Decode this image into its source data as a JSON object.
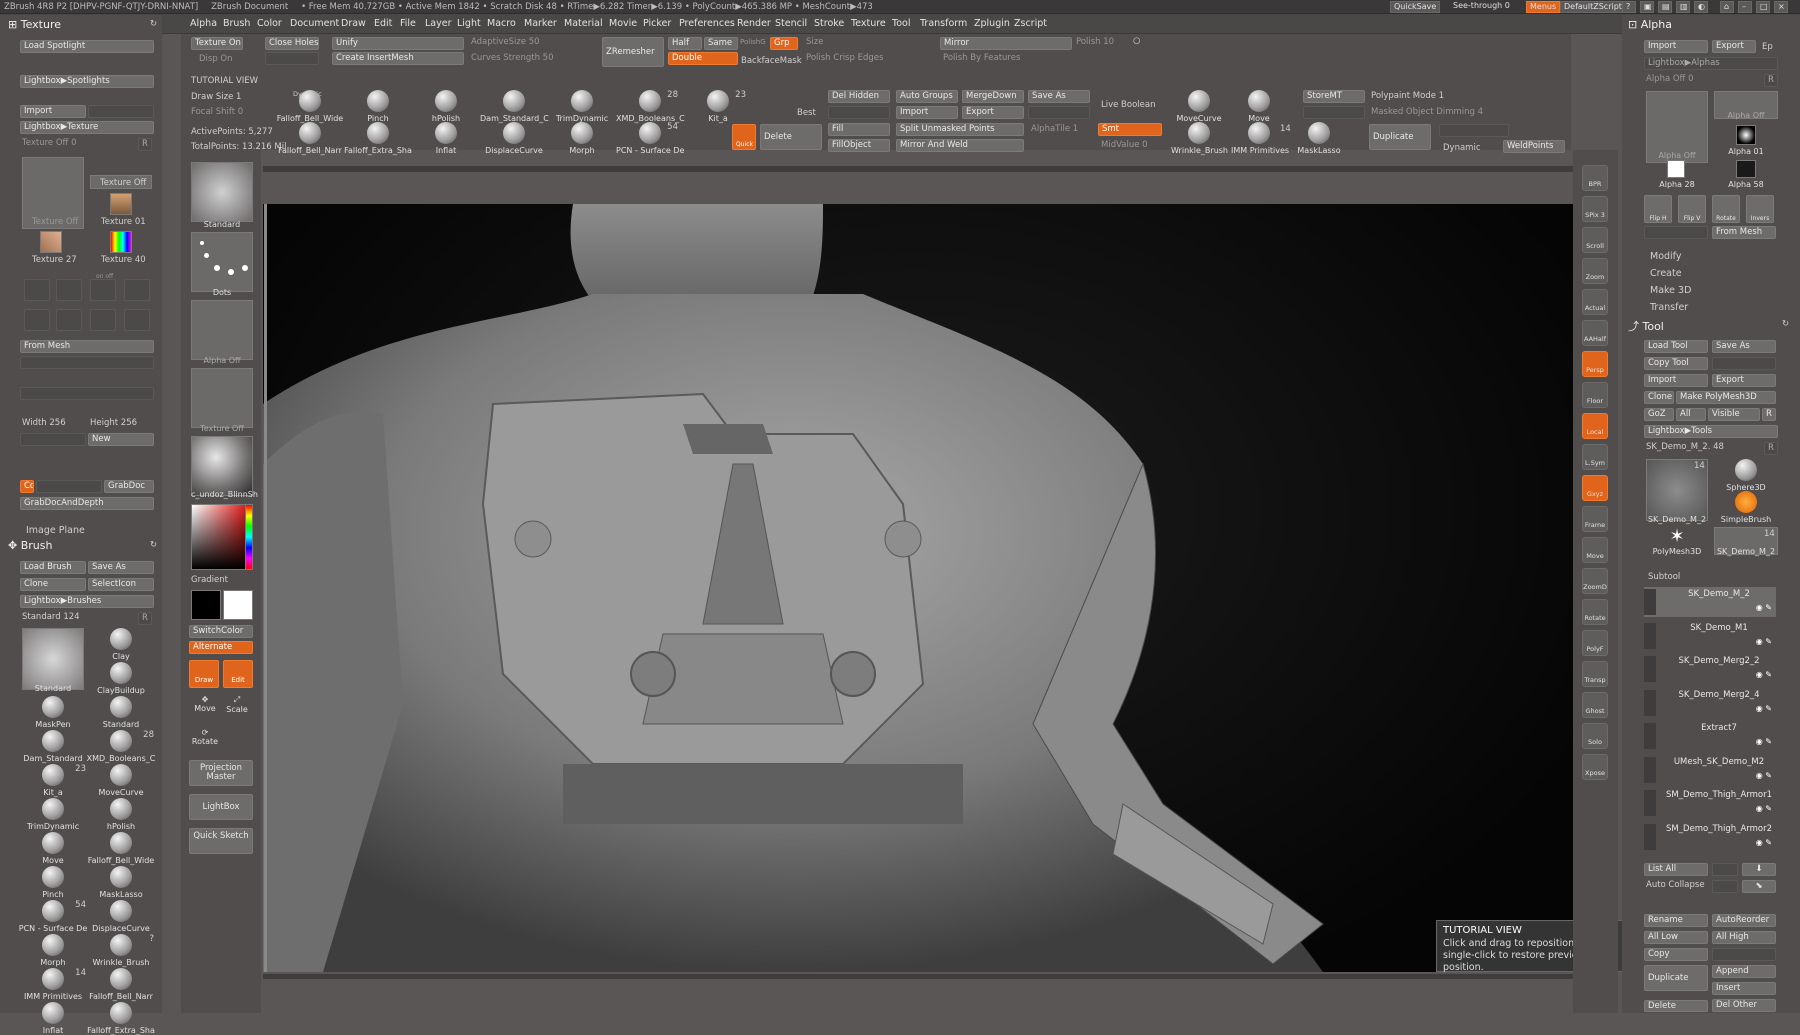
{
  "titlebar": {
    "app": "ZBrush 4R8 P2 [DHPV-PGNF-QTJY-DRNI-NNAT]",
    "doc": "ZBrush Document",
    "stats": "• Free Mem 40.727GB • Active Mem 1842 • Scratch Disk 48 • RTime▶6.282 Timer▶6.139 • PolyCount▶465.386 MP • MeshCount▶473",
    "right": [
      "QuickSave",
      "See-through 0",
      "Menus",
      "DefaultZScript"
    ]
  },
  "menus": [
    "Alpha",
    "Brush",
    "Color",
    "Document",
    "Draw",
    "Edit",
    "File",
    "Layer",
    "Light",
    "Macro",
    "Marker",
    "Material",
    "Movie",
    "Picker",
    "Preferences",
    "Render",
    "Stencil",
    "Stroke",
    "Texture",
    "Tool",
    "Transform",
    "Zplugin",
    "Zscript"
  ],
  "texture_panel": {
    "title": "Texture",
    "load_spotlight": "Load Spotlight",
    "lightbox_spotlights": "Lightbox▶Spotlights",
    "import": "Import",
    "lightbox_texture": "Lightbox▶Texture",
    "texture_off_slider": "Texture Off 0",
    "r": "R",
    "thumbs": [
      "Texture Off",
      "Texture Off",
      "Texture 01",
      "Texture 27",
      "Texture 40"
    ],
    "onoff": "on off",
    "from_mesh": "From Mesh",
    "width": "Width 256",
    "height": "Height 256",
    "new": "New",
    "cd": "Cd",
    "grabdoc": "GrabDoc",
    "grabdocanddepth": "GrabDocAndDepth",
    "image_plane": "Image Plane"
  },
  "brush_panel": {
    "title": "Brush",
    "load_brush": "Load Brush",
    "save_as": "Save As",
    "clone": "Clone",
    "select_icon": "SelectIcon",
    "lightbox_brushes": "Lightbox▶Brushes",
    "standard_slider": "Standard 124",
    "r": "R",
    "brushes": [
      {
        "name": "Standard"
      },
      {
        "name": "Clay"
      },
      {
        "name": "ClayBuildup"
      },
      {
        "name": "MaskPen"
      },
      {
        "name": "Standard"
      },
      {
        "name": "Dam_Standard"
      },
      {
        "name": "XMD_Booleans_C",
        "count": "28"
      },
      {
        "name": "Kit_a",
        "count": "23"
      },
      {
        "name": "MoveCurve"
      },
      {
        "name": "TrimDynamic"
      },
      {
        "name": "hPolish"
      },
      {
        "name": "Move"
      },
      {
        "name": "Falloff_Bell_Wide"
      },
      {
        "name": "Pinch"
      },
      {
        "name": "MaskLasso"
      },
      {
        "name": "PCN - Surface De",
        "count": "54"
      },
      {
        "name": "DisplaceCurve"
      },
      {
        "name": "Morph"
      },
      {
        "name": "Wrinkle_Brush",
        "count": "?"
      },
      {
        "name": "IMM Primitives",
        "count": "14"
      },
      {
        "name": "Falloff_Bell_Narr"
      },
      {
        "name": "Inflat"
      },
      {
        "name": "Falloff_Extra_Sha"
      }
    ]
  },
  "left_shelf": {
    "standard": "Standard",
    "dots": "Dots",
    "alpha_off": "Alpha Off",
    "texture_off": "Texture Off",
    "material": "c_undoz_BlinnSh",
    "gradient": "Gradient",
    "switch_color": "SwitchColor",
    "alternate": "Alternate",
    "draw": "Draw",
    "edit": "Edit",
    "move": "Move",
    "scale": "Scale",
    "rotate": "Rotate",
    "projection_master": "Projection Master",
    "lightbox": "LightBox",
    "quick_sketch": "Quick Sketch"
  },
  "top_shelf": {
    "texture_on": "Texture On",
    "disp_on": "Disp On",
    "close_holes": "Close Holes",
    "unify": "Unify",
    "create_insertmesh": "Create InsertMesh",
    "adaptive_size": "AdaptiveSize 50",
    "curves_strength": "Curves Strength 50",
    "zremesher": "ZRemesher",
    "half": "Half",
    "same": "Same",
    "double": "Double",
    "polishg": "PolishG",
    "grp": "Grp",
    "size": "Size",
    "backfacemask": "BackfaceMask",
    "polish_crisp": "Polish Crisp Edges",
    "mirror": "Mirror",
    "polish_by_features": "Polish By Features",
    "polish": "Polish 10",
    "tutorial_view": "TUTORIAL VIEW",
    "draw_size": "Draw Size 1",
    "dynamic": "Dynamic",
    "focal_shift": "Focal Shift 0",
    "active_points": "ActivePoints: 5,277",
    "total_points": "TotalPoints: 13.216 Mil",
    "brushes": [
      {
        "name": "Falloff_Bell_Wide"
      },
      {
        "name": "Pinch"
      },
      {
        "name": "hPolish"
      },
      {
        "name": "Dam_Standard_C"
      },
      {
        "name": "TrimDynamic"
      },
      {
        "name": "XMD_Booleans_C",
        "count": "28"
      },
      {
        "name": "Kit_a",
        "count": "23"
      },
      {
        "name": "Falloff_Bell_Narr"
      },
      {
        "name": "Falloff_Extra_Sha"
      },
      {
        "name": "Inflat"
      },
      {
        "name": "DisplaceCurve"
      },
      {
        "name": "Morph"
      },
      {
        "name": "PCN - Surface De",
        "count": "54"
      }
    ],
    "best": "Best",
    "quick": "Quick",
    "delete": "Delete",
    "del_hidden": "Del Hidden",
    "auto_groups": "Auto Groups",
    "merge_down": "MergeDown",
    "save_as": "Save As",
    "import": "Import",
    "export": "Export",
    "live_boolean": "Live Boolean",
    "fill": "Fill",
    "split_unmasked": "Split Unmasked Points",
    "alpha_tile": "AlphaTile 1",
    "smt": "Smt",
    "fill_object": "FillObject",
    "mirror_and_weld": "Mirror And Weld",
    "mid_value": "MidValue 0",
    "movecurve": "MoveCurve",
    "move": "Move",
    "wrinkle": "Wrinkle_Brush",
    "imm": "IMM Primitives",
    "imm_count": "14",
    "masklasso": "MaskLasso",
    "store_mt": "StoreMT",
    "polypaint_mode": "Polypaint Mode 1",
    "masked_object_dimming": "Masked Object Dimming 4",
    "duplicate": "Duplicate",
    "dynamic2": "Dynamic",
    "weldpoints": "WeldPoints"
  },
  "viewport_tools": [
    "BPR",
    "SPix 3",
    "Scroll",
    "Zoom",
    "Actual",
    "AAHalf",
    "Persp",
    "Floor",
    "Local",
    "L.Sym",
    "Gxyz",
    "Frame",
    "Move",
    "ZoomD",
    "Rotate",
    "PolyF",
    "Transp",
    "Ghost",
    "Solo",
    "Xpose"
  ],
  "alpha_panel": {
    "title": "Alpha",
    "import": "Import",
    "export": "Export",
    "ep": "Ep",
    "lightbox_alphas": "Lightbox▶Alphas",
    "alpha_off_slider": "Alpha Off 0",
    "r": "R",
    "thumbs": [
      "Alpha Off",
      "Alpha Off",
      "Alpha 01",
      "Alpha 28",
      "Alpha 58"
    ],
    "tools": [
      "Flip H",
      "Flip V",
      "Rotate",
      "Invers"
    ],
    "from_mesh": "From Mesh",
    "sections": [
      "Modify",
      "Create",
      "Make 3D",
      "Transfer"
    ]
  },
  "tool_panel": {
    "title": "Tool",
    "load_tool": "Load Tool",
    "save_as": "Save As",
    "copy_tool": "Copy Tool",
    "import": "Import",
    "export": "Export",
    "clone": "Clone",
    "make_polymesh": "Make PolyMesh3D",
    "goz": "GoZ",
    "all": "All",
    "visible": "Visible",
    "r": "R",
    "lightbox_tools": "Lightbox▶Tools",
    "current": "SK_Demo_M_2. 48",
    "thumbs": [
      {
        "name": "SK_Demo_M_2",
        "count": "14"
      },
      {
        "name": "Sphere3D"
      },
      {
        "name": "SimpleBrush"
      },
      {
        "name": "PolyMesh3D"
      },
      {
        "name": "SK_Demo_M_2",
        "count": "14"
      }
    ],
    "subtool": "Subtool",
    "subtools": [
      "SK_Demo_M_2",
      "SK_Demo_M1",
      "SK_Demo_Merg2_2",
      "SK_Demo_Merg2_4",
      "Extract7",
      "UMesh_SK_Demo_M2",
      "SM_Demo_Thigh_Armor1",
      "SM_Demo_Thigh_Armor2"
    ],
    "list_all": "List All",
    "auto_collapse": "Auto Collapse",
    "rename": "Rename",
    "auto_reorder": "AutoReorder",
    "all_low": "All Low",
    "all_high": "All High",
    "copy": "Copy",
    "duplicate": "Duplicate",
    "append": "Append",
    "insert": "Insert",
    "del_other": "Del Other",
    "delete": "Delete"
  },
  "tutorial_tip": {
    "title": "TUTORIAL VIEW",
    "text": "Click and drag to reposition, or single-click to restore previous position."
  },
  "colors": {
    "accent": "#e0641c",
    "panel": "#514d4d",
    "button": "#6e6b6b"
  }
}
